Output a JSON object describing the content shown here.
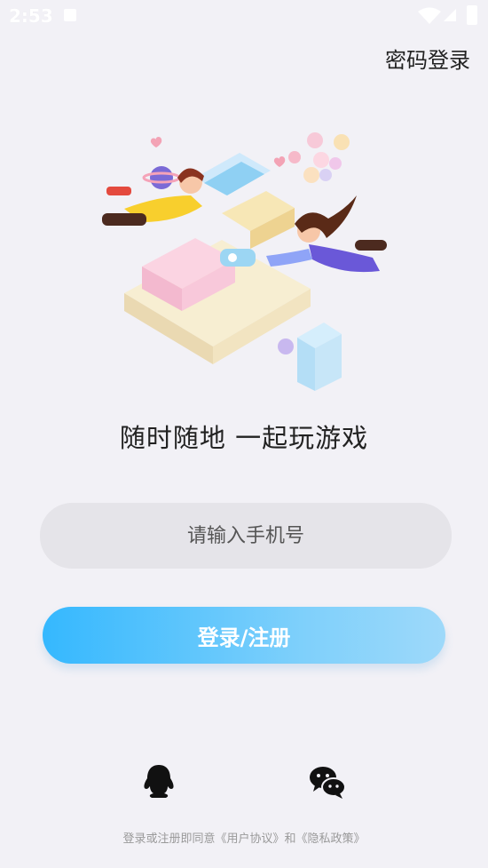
{
  "status": {
    "time": "2:53"
  },
  "header": {
    "password_login": "密码登录"
  },
  "slogan": "随时随地  一起玩游戏",
  "phone": {
    "placeholder": "请输入手机号",
    "value": ""
  },
  "login_button": "登录/注册",
  "social": {
    "qq_icon": "qq-icon",
    "wechat_icon": "wechat-icon"
  },
  "agreement": "登录或注册即同意《用户协议》和《隐私政策》",
  "colors": {
    "background": "#f2f1f6",
    "button_gradient_start": "#35b8fe",
    "button_gradient_end": "#9ed9fa",
    "input_bg": "#e5e4e9"
  }
}
